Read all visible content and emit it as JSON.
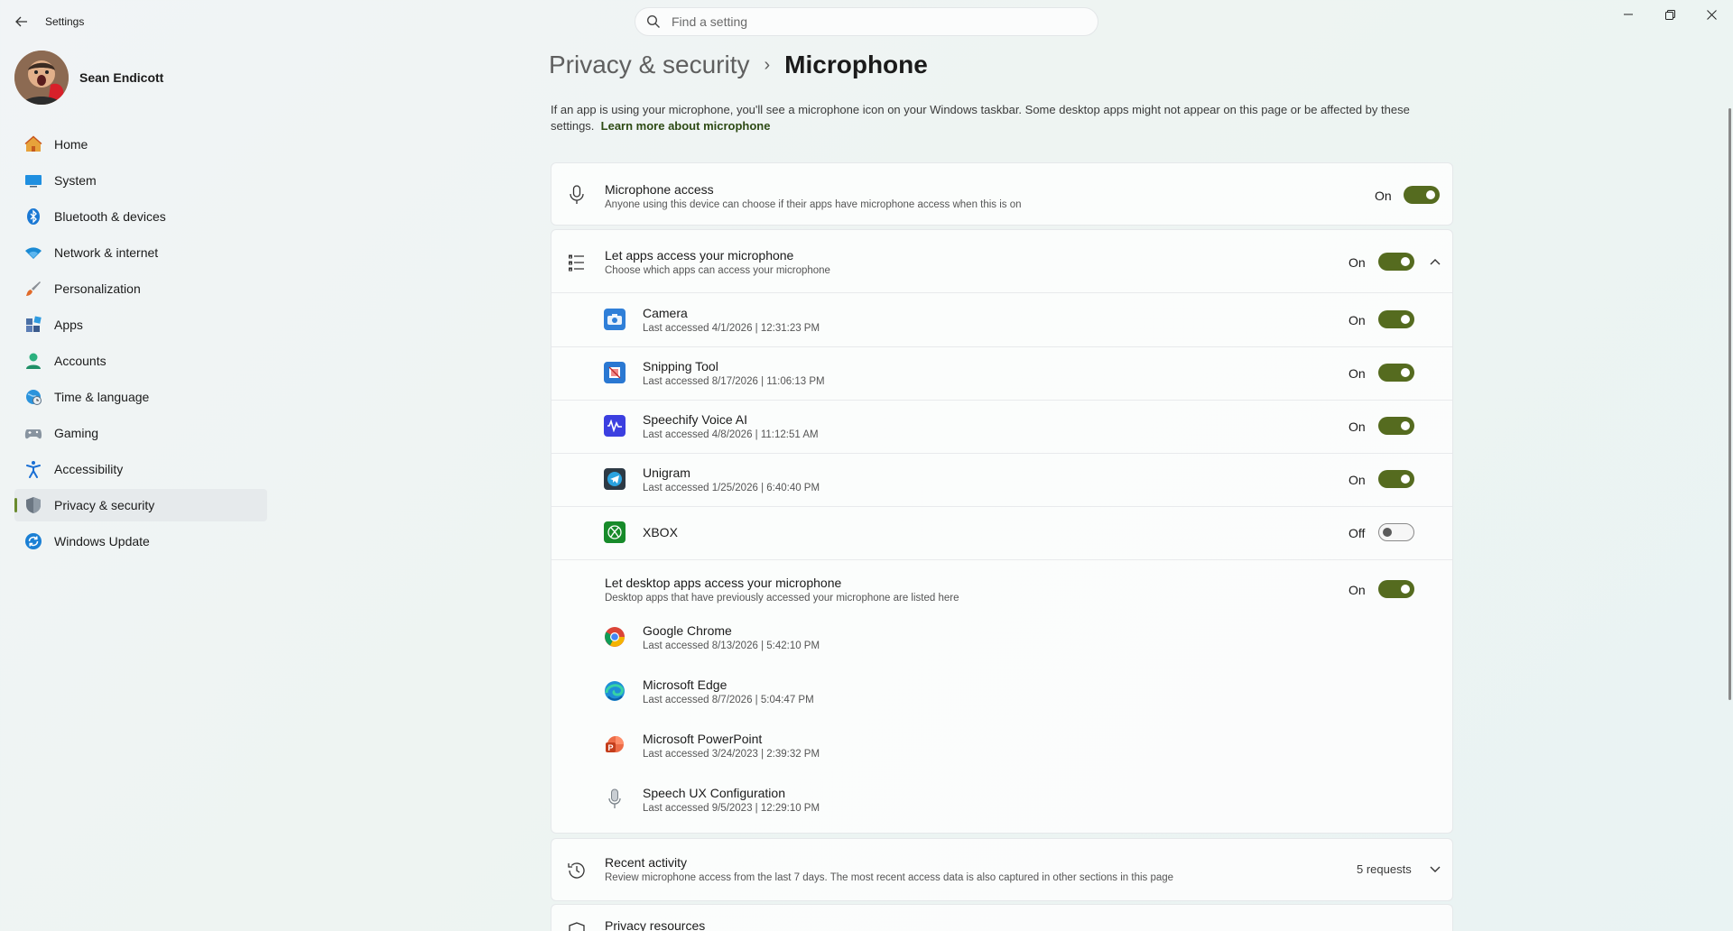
{
  "window": {
    "title": "Settings",
    "back_icon": "back-arrow-icon",
    "controls": [
      "minimize-icon",
      "restore-icon",
      "close-icon"
    ]
  },
  "search": {
    "placeholder": "Find a setting",
    "value": ""
  },
  "profile": {
    "name": "Sean Endicott"
  },
  "sidebar": {
    "items": [
      {
        "label": "Home",
        "icon": "home-icon",
        "color": "#e07a2f"
      },
      {
        "label": "System",
        "icon": "system-icon",
        "color": "#1a8ad4"
      },
      {
        "label": "Bluetooth & devices",
        "icon": "bluetooth-icon",
        "color": "#1a8ad4"
      },
      {
        "label": "Network & internet",
        "icon": "wifi-icon",
        "color": "#1a8ad4"
      },
      {
        "label": "Personalization",
        "icon": "brush-icon",
        "color": "#d9692c"
      },
      {
        "label": "Apps",
        "icon": "apps-icon",
        "color": "#4a6fa5"
      },
      {
        "label": "Accounts",
        "icon": "accounts-icon",
        "color": "#2aa377"
      },
      {
        "label": "Time & language",
        "icon": "globe-icon",
        "color": "#1a8ad4"
      },
      {
        "label": "Gaming",
        "icon": "gamepad-icon",
        "color": "#7b8794"
      },
      {
        "label": "Accessibility",
        "icon": "accessibility-icon",
        "color": "#1a6fd4"
      },
      {
        "label": "Privacy & security",
        "icon": "shield-icon",
        "color": "#6b7682",
        "active": true
      },
      {
        "label": "Windows Update",
        "icon": "update-icon",
        "color": "#1a7fd4"
      }
    ]
  },
  "page": {
    "breadcrumb_parent": "Privacy & security",
    "breadcrumb_separator": "›",
    "title": "Microphone",
    "description": "If an app is using your microphone, you'll see a microphone icon on your Windows taskbar. Some desktop apps might not appear on this page or be affected by these settings.",
    "learn_more": "Learn more about microphone"
  },
  "microphone_access": {
    "title": "Microphone access",
    "subtitle": "Anyone using this device can choose if their apps have microphone access when this is on",
    "state": "On"
  },
  "let_apps": {
    "title": "Let apps access your microphone",
    "subtitle": "Choose which apps can access your microphone",
    "state": "On"
  },
  "apps": [
    {
      "name": "Camera",
      "accessed": "Last accessed 4/1/2026  |  12:31:23 PM",
      "state": "On",
      "icon": "camera-app-icon"
    },
    {
      "name": "Snipping Tool",
      "accessed": "Last accessed 8/17/2026  |  11:06:13 PM",
      "state": "On",
      "icon": "snipping-tool-icon"
    },
    {
      "name": "Speechify Voice AI",
      "accessed": "Last accessed 4/8/2026  |  11:12:51 AM",
      "state": "On",
      "icon": "speechify-icon"
    },
    {
      "name": "Unigram",
      "accessed": "Last accessed 1/25/2026  |  6:40:40 PM",
      "state": "On",
      "icon": "unigram-icon"
    },
    {
      "name": "XBOX",
      "accessed": "",
      "state": "Off",
      "icon": "xbox-icon"
    }
  ],
  "desktop": {
    "title": "Let desktop apps access your microphone",
    "subtitle": "Desktop apps that have previously accessed your microphone are listed here",
    "state": "On",
    "apps": [
      {
        "name": "Google Chrome",
        "accessed": "Last accessed 8/13/2026  |  5:42:10 PM",
        "icon": "chrome-icon"
      },
      {
        "name": "Microsoft Edge",
        "accessed": "Last accessed 8/7/2026  |  5:04:47 PM",
        "icon": "edge-icon"
      },
      {
        "name": "Microsoft PowerPoint",
        "accessed": "Last accessed 3/24/2023  |  2:39:32 PM",
        "icon": "powerpoint-icon"
      },
      {
        "name": "Speech UX Configuration",
        "accessed": "Last accessed 9/5/2023  |  12:29:10 PM",
        "icon": "microphone-app-icon"
      }
    ]
  },
  "recent": {
    "title": "Recent activity",
    "subtitle": "Review microphone access from the last 7 days. The most recent access data is also captured in other sections in this page",
    "count": "5 requests"
  },
  "privacy_resources": {
    "title": "Privacy resources"
  }
}
